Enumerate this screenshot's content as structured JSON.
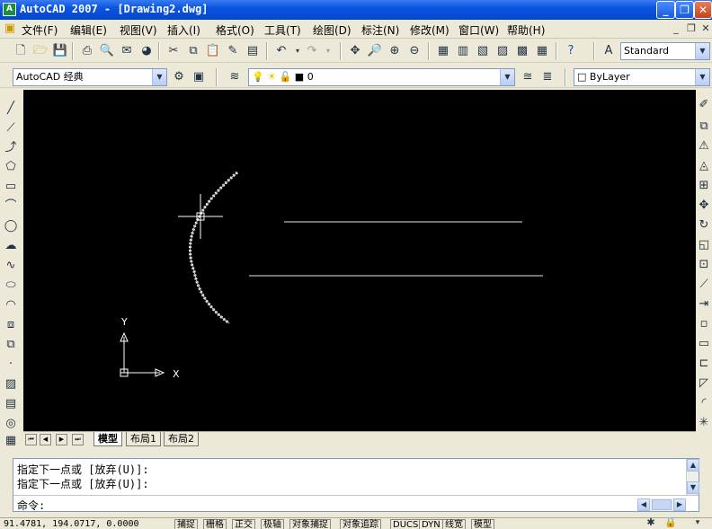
{
  "window": {
    "title": "AutoCAD 2007 - [Drawing2.dwg]",
    "minimize": "_",
    "restore": "❐",
    "close": "✕"
  },
  "menu": {
    "items": [
      {
        "label": "文件(F)"
      },
      {
        "label": "编辑(E)"
      },
      {
        "label": "视图(V)"
      },
      {
        "label": "插入(I)"
      },
      {
        "label": "格式(O)"
      },
      {
        "label": "工具(T)"
      },
      {
        "label": "绘图(D)"
      },
      {
        "label": "标注(N)"
      },
      {
        "label": "修改(M)"
      },
      {
        "label": "窗口(W)"
      },
      {
        "label": "帮助(H)"
      }
    ],
    "doc_minimize": "_",
    "doc_restore": "❐",
    "doc_close": "✕"
  },
  "toolbar_standard": {
    "text_style_value": "Standard"
  },
  "toolbar_layers": {
    "workspace_value": "AutoCAD 经典",
    "layer_value": "0",
    "color_value": "ByLayer"
  },
  "layout_tabs": [
    {
      "label": "模型",
      "active": true
    },
    {
      "label": "布局1",
      "active": false
    },
    {
      "label": "布局2",
      "active": false
    }
  ],
  "command_window": {
    "history": [
      "指定下一点或 [放弃(U)]:",
      "指定下一点或 [放弃(U)]:"
    ],
    "prompt": "命令:"
  },
  "status_bar": {
    "coordinates": "91.4781, 194.0717, 0.0000",
    "toggles": [
      "捕捉",
      "栅格",
      "正交",
      "极轴",
      "对象捕捉",
      "对象追踪",
      "DUCS",
      "DYN",
      "线宽",
      "模型"
    ]
  },
  "ucs": {
    "x_label": "X",
    "y_label": "Y"
  },
  "colors": {
    "canvas": "#000000",
    "titlebar": "#0a55e0",
    "drawing_lines": "#ffffff"
  }
}
